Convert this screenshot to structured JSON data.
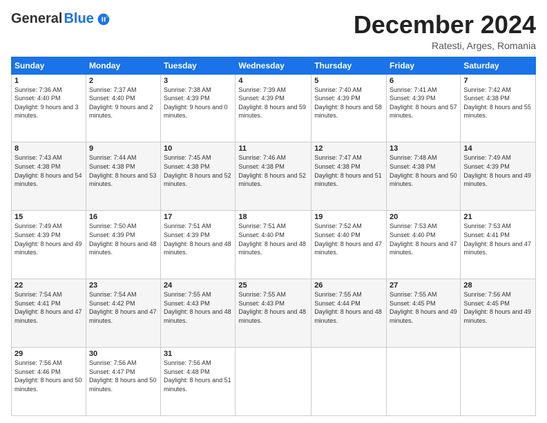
{
  "header": {
    "logo_general": "General",
    "logo_blue": "Blue",
    "month_title": "December 2024",
    "location": "Ratesti, Arges, Romania"
  },
  "weekdays": [
    "Sunday",
    "Monday",
    "Tuesday",
    "Wednesday",
    "Thursday",
    "Friday",
    "Saturday"
  ],
  "weeks": [
    [
      {
        "day": "1",
        "sunrise": "7:36 AM",
        "sunset": "4:40 PM",
        "daylight": "9 hours and 3 minutes."
      },
      {
        "day": "2",
        "sunrise": "7:37 AM",
        "sunset": "4:40 PM",
        "daylight": "9 hours and 2 minutes."
      },
      {
        "day": "3",
        "sunrise": "7:38 AM",
        "sunset": "4:39 PM",
        "daylight": "9 hours and 0 minutes."
      },
      {
        "day": "4",
        "sunrise": "7:39 AM",
        "sunset": "4:39 PM",
        "daylight": "8 hours and 59 minutes."
      },
      {
        "day": "5",
        "sunrise": "7:40 AM",
        "sunset": "4:39 PM",
        "daylight": "8 hours and 58 minutes."
      },
      {
        "day": "6",
        "sunrise": "7:41 AM",
        "sunset": "4:39 PM",
        "daylight": "8 hours and 57 minutes."
      },
      {
        "day": "7",
        "sunrise": "7:42 AM",
        "sunset": "4:38 PM",
        "daylight": "8 hours and 55 minutes."
      }
    ],
    [
      {
        "day": "8",
        "sunrise": "7:43 AM",
        "sunset": "4:38 PM",
        "daylight": "8 hours and 54 minutes."
      },
      {
        "day": "9",
        "sunrise": "7:44 AM",
        "sunset": "4:38 PM",
        "daylight": "8 hours and 53 minutes."
      },
      {
        "day": "10",
        "sunrise": "7:45 AM",
        "sunset": "4:38 PM",
        "daylight": "8 hours and 52 minutes."
      },
      {
        "day": "11",
        "sunrise": "7:46 AM",
        "sunset": "4:38 PM",
        "daylight": "8 hours and 52 minutes."
      },
      {
        "day": "12",
        "sunrise": "7:47 AM",
        "sunset": "4:38 PM",
        "daylight": "8 hours and 51 minutes."
      },
      {
        "day": "13",
        "sunrise": "7:48 AM",
        "sunset": "4:38 PM",
        "daylight": "8 hours and 50 minutes."
      },
      {
        "day": "14",
        "sunrise": "7:49 AM",
        "sunset": "4:39 PM",
        "daylight": "8 hours and 49 minutes."
      }
    ],
    [
      {
        "day": "15",
        "sunrise": "7:49 AM",
        "sunset": "4:39 PM",
        "daylight": "8 hours and 49 minutes."
      },
      {
        "day": "16",
        "sunrise": "7:50 AM",
        "sunset": "4:39 PM",
        "daylight": "8 hours and 48 minutes."
      },
      {
        "day": "17",
        "sunrise": "7:51 AM",
        "sunset": "4:39 PM",
        "daylight": "8 hours and 48 minutes."
      },
      {
        "day": "18",
        "sunrise": "7:51 AM",
        "sunset": "4:40 PM",
        "daylight": "8 hours and 48 minutes."
      },
      {
        "day": "19",
        "sunrise": "7:52 AM",
        "sunset": "4:40 PM",
        "daylight": "8 hours and 47 minutes."
      },
      {
        "day": "20",
        "sunrise": "7:53 AM",
        "sunset": "4:40 PM",
        "daylight": "8 hours and 47 minutes."
      },
      {
        "day": "21",
        "sunrise": "7:53 AM",
        "sunset": "4:41 PM",
        "daylight": "8 hours and 47 minutes."
      }
    ],
    [
      {
        "day": "22",
        "sunrise": "7:54 AM",
        "sunset": "4:41 PM",
        "daylight": "8 hours and 47 minutes."
      },
      {
        "day": "23",
        "sunrise": "7:54 AM",
        "sunset": "4:42 PM",
        "daylight": "8 hours and 47 minutes."
      },
      {
        "day": "24",
        "sunrise": "7:55 AM",
        "sunset": "4:43 PM",
        "daylight": "8 hours and 48 minutes."
      },
      {
        "day": "25",
        "sunrise": "7:55 AM",
        "sunset": "4:43 PM",
        "daylight": "8 hours and 48 minutes."
      },
      {
        "day": "26",
        "sunrise": "7:55 AM",
        "sunset": "4:44 PM",
        "daylight": "8 hours and 48 minutes."
      },
      {
        "day": "27",
        "sunrise": "7:55 AM",
        "sunset": "4:45 PM",
        "daylight": "8 hours and 49 minutes."
      },
      {
        "day": "28",
        "sunrise": "7:56 AM",
        "sunset": "4:45 PM",
        "daylight": "8 hours and 49 minutes."
      }
    ],
    [
      {
        "day": "29",
        "sunrise": "7:56 AM",
        "sunset": "4:46 PM",
        "daylight": "8 hours and 50 minutes."
      },
      {
        "day": "30",
        "sunrise": "7:56 AM",
        "sunset": "4:47 PM",
        "daylight": "8 hours and 50 minutes."
      },
      {
        "day": "31",
        "sunrise": "7:56 AM",
        "sunset": "4:48 PM",
        "daylight": "8 hours and 51 minutes."
      },
      null,
      null,
      null,
      null
    ]
  ]
}
